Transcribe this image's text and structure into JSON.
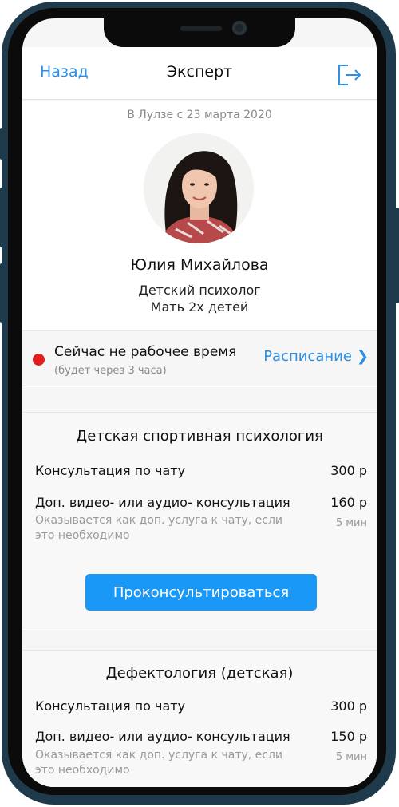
{
  "navbar": {
    "back_label": "Назад",
    "title": "Эксперт",
    "exit_icon": "logout-icon"
  },
  "profile": {
    "member_since": "В Лулзе с 23 марта 2020",
    "name": "Юлия Михайлова",
    "role": "Детский психолог",
    "role_extra": "Мать 2х детей"
  },
  "status": {
    "main": "Сейчас не рабочее время",
    "sub": "(будет через 3 часа)",
    "schedule_label": "Расписание",
    "dot_color": "#e21d1d"
  },
  "services": [
    {
      "title": "Детская спортивная психология",
      "chat_label": "Консультация по чату",
      "chat_price": "300 р",
      "extra_label": "Доп. видео- или аудио- консультация",
      "extra_price": "160 р",
      "extra_note": "Оказывается как доп. услуга к чату, если это необходимо",
      "extra_duration": "5 мин",
      "button_label": "Проконсультироваться"
    },
    {
      "title": "Дефектология (детская)",
      "chat_label": "Консультация по чату",
      "chat_price": "300 р",
      "extra_label": "Доп. видео- или аудио- консультация",
      "extra_price": "150 р",
      "extra_note": "Оказывается как доп. услуга к чату, если это необходимо",
      "extra_duration": "5 мин"
    }
  ],
  "colors": {
    "accent": "#2b8fe6",
    "button": "#1a98f7",
    "frame": "#1f3a4a"
  }
}
